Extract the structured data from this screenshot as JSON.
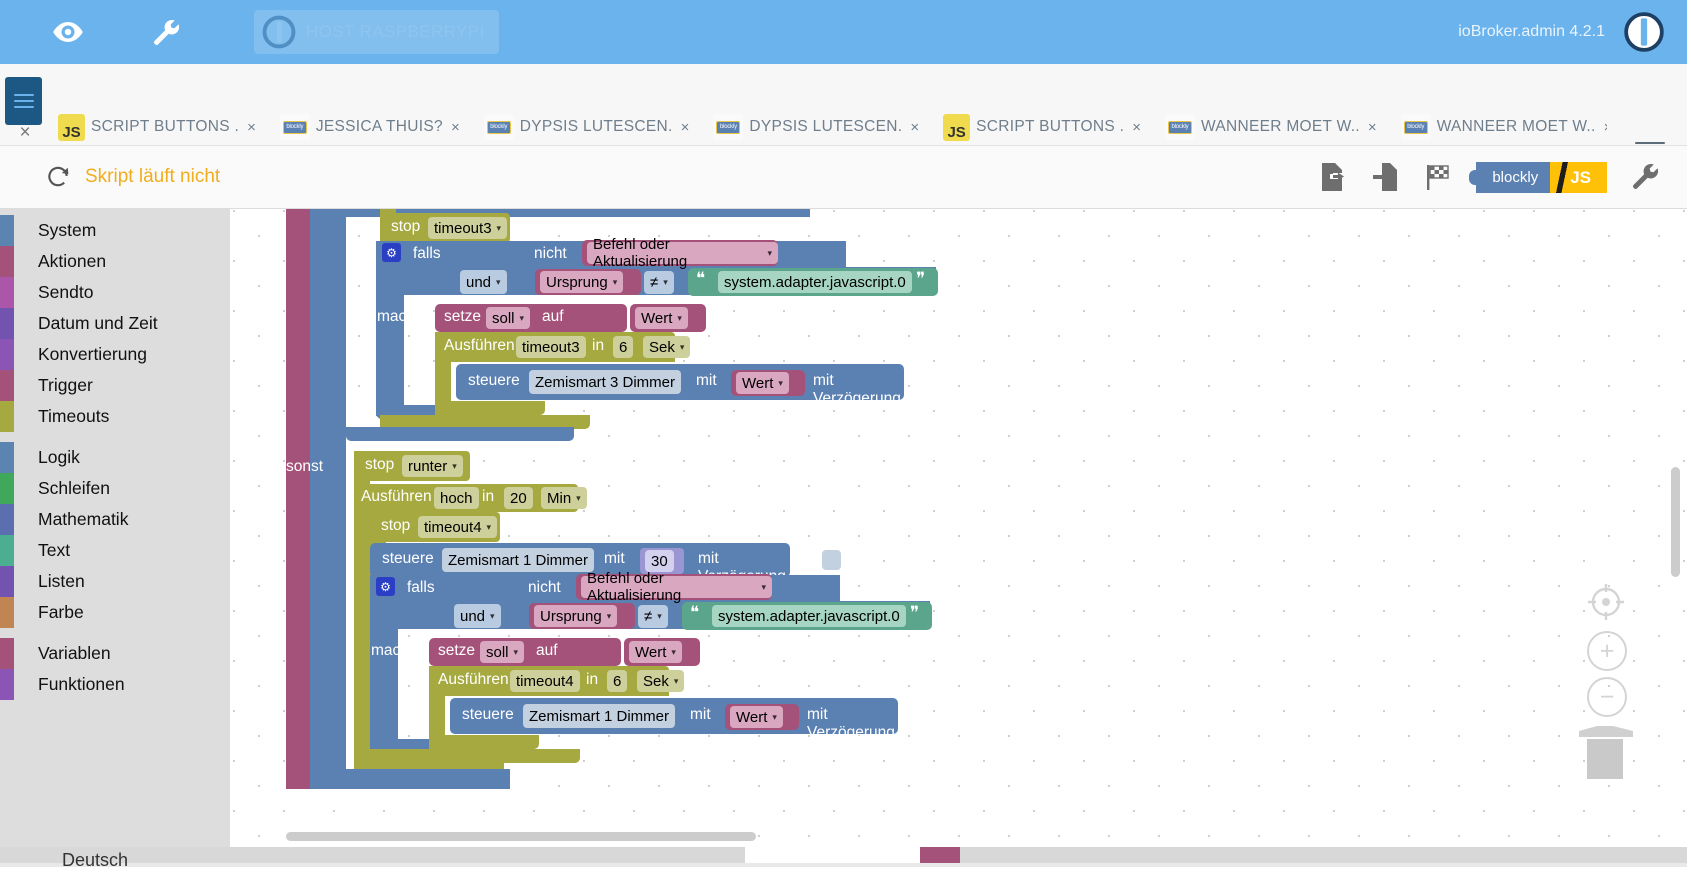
{
  "header": {
    "eye_icon": "eye-icon",
    "wrench_icon": "wrench-icon",
    "host_label": "HOST RASPBERRYPI",
    "version": "ioBroker.admin 4.2.1",
    "logo_icon": "iobroker-logo-icon"
  },
  "tabbar": {
    "menu_icon": "hamburger-icon",
    "close_all": "×",
    "overflow_icon": "blockly-icon",
    "tabs": [
      {
        "icon": "js-icon",
        "label": "SCRIPT BUTTONS .",
        "close": "×"
      },
      {
        "icon": "blockly-icon",
        "label": "JESSICA THUIS?",
        "close": "×"
      },
      {
        "icon": "blockly-icon",
        "label": "DYPSIS LUTESCEN.",
        "close": "×"
      },
      {
        "icon": "blockly-icon",
        "label": "DYPSIS LUTESCEN.",
        "close": "×"
      },
      {
        "icon": "js-icon",
        "label": "SCRIPT BUTTONS .",
        "close": "×"
      },
      {
        "icon": "blockly-icon",
        "label": "WANNEER MOET W..",
        "close": "×"
      },
      {
        "icon": "blockly-icon",
        "label": "WANNEER MOET W..",
        "close": "×"
      }
    ]
  },
  "scripttoolbar": {
    "reload_icon": "reload-icon",
    "status_text": "Skript läuft nicht",
    "status_color": "#f0ad1e",
    "export_icon": "export-blocks-icon",
    "import_icon": "import-blocks-icon",
    "checkered_flag_icon": "checkered-flag-icon",
    "mode_blockly": "blockly",
    "mode_js": "JS",
    "settings_icon": "wrench-icon"
  },
  "toolbox": {
    "groups": [
      {
        "items": [
          {
            "label": "System",
            "color": "#5b85b0"
          },
          {
            "label": "Aktionen",
            "color": "#a5527a"
          },
          {
            "label": "Sendto",
            "color": "#ab56a8"
          },
          {
            "label": "Datum und Zeit",
            "color": "#7254b0"
          },
          {
            "label": "Konvertierung",
            "color": "#8b55b5"
          },
          {
            "label": "Trigger",
            "color": "#a5527a"
          },
          {
            "label": "Timeouts",
            "color": "#a5a93f"
          }
        ]
      },
      {
        "items": [
          {
            "label": "Logik",
            "color": "#5b85b0"
          },
          {
            "label": "Schleifen",
            "color": "#3fa85b"
          },
          {
            "label": "Mathematik",
            "color": "#5b6fb0"
          },
          {
            "label": "Text",
            "color": "#4cae90"
          },
          {
            "label": "Listen",
            "color": "#7254b0"
          },
          {
            "label": "Farbe",
            "color": "#c08552"
          }
        ]
      },
      {
        "items": [
          {
            "label": "Variablen",
            "color": "#a5527a"
          },
          {
            "label": "Funktionen",
            "color": "#8b55b5"
          }
        ]
      }
    ]
  },
  "workspace": {
    "zoom_center_icon": "zoom-center-icon",
    "zoom_in_icon": "+",
    "zoom_out_icon": "−",
    "trash_icon": "trash-icon",
    "blocks": {
      "stop_timeout3": {
        "verb": "stop",
        "target": "timeout3"
      },
      "if1": {
        "label": "falls",
        "gear": "gear-icon",
        "not": "nicht",
        "condition_a": "Befehl oder Aktualisierung",
        "operator": "und",
        "left": "Ursprung",
        "compare": "≠",
        "right": "system.adapter.javascript.0",
        "quote_open": "❝",
        "quote_close": "❞",
        "do_label": "mache",
        "set_verb": "setze",
        "set_target": "soll",
        "set_to": "auf",
        "set_value": "Wert",
        "run_verb": "Ausführen",
        "run_name": "timeout3",
        "run_in": "in",
        "run_amount": "6",
        "run_unit": "Sek",
        "control_verb": "steuere",
        "control_target": "Zemismart 3  Dimmer",
        "control_with": "mit",
        "control_value": "Wert",
        "control_delay": "mit Verzögerung"
      },
      "else_label": "sonst",
      "stop_runter": {
        "verb": "stop",
        "target": "runter"
      },
      "run_hoch": {
        "verb": "Ausführen",
        "name": "hoch",
        "in": "in",
        "amount": "20",
        "unit": "Min"
      },
      "stop_timeout4": {
        "verb": "stop",
        "target": "timeout4"
      },
      "control_zem1": {
        "verb": "steuere",
        "target": "Zemismart 1  Dimmer",
        "with": "mit",
        "value": "30",
        "delay": "mit Verzögerung"
      },
      "if2": {
        "label": "falls",
        "gear": "gear-icon",
        "not": "nicht",
        "condition_a": "Befehl oder Aktualisierung",
        "operator": "und",
        "left": "Ursprung",
        "compare": "≠",
        "right": "system.adapter.javascript.0",
        "quote_open": "❝",
        "quote_close": "❞",
        "do_label": "mache",
        "set_verb": "setze",
        "set_target": "soll",
        "set_to": "auf",
        "set_value": "Wert",
        "run_verb": "Ausführen",
        "run_name": "timeout4",
        "run_in": "in",
        "run_amount": "6",
        "run_unit": "Sek",
        "control_verb": "steuere",
        "control_target": "Zemismart 1  Dimmer",
        "control_with": "mit",
        "control_value": "Wert",
        "control_delay": "mit Verzögerung"
      }
    }
  },
  "bottom": {
    "label": "Deutsch"
  }
}
